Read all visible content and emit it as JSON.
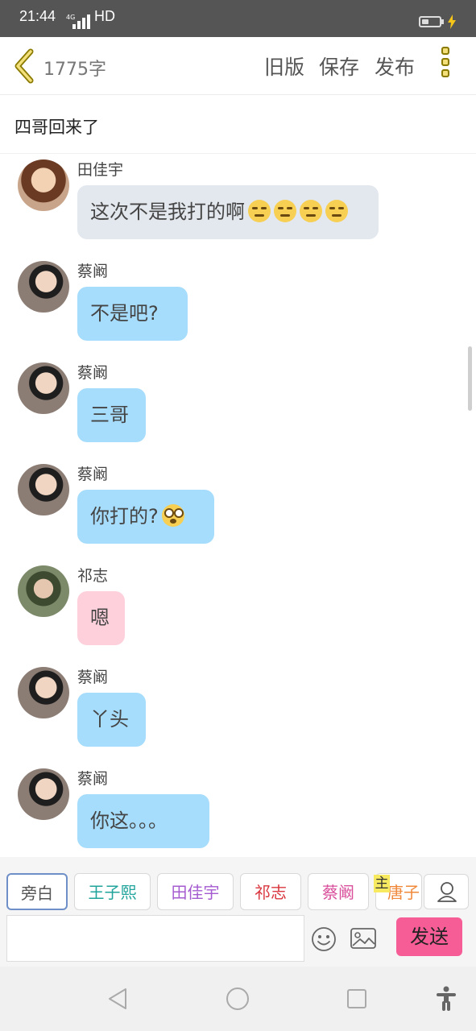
{
  "status_bar": {
    "time": "21:44",
    "network": "4G",
    "hd": "HD"
  },
  "header": {
    "word_count": "1775字",
    "old_version_label": "旧版",
    "save_label": "保存",
    "publish_label": "发布"
  },
  "title": "四哥回来了",
  "messages": [
    {
      "name": "田佳宇",
      "text": "这次不是我打的啊",
      "bubble_color": "#e3e8ee",
      "emoji_count": 4,
      "emoji": "unamused-emoji"
    },
    {
      "name": "蔡阚",
      "text": "不是吧?",
      "bubble_color": "#a6dcfc"
    },
    {
      "name": "蔡阚",
      "text": "三哥",
      "bubble_color": "#a6dcfc"
    },
    {
      "name": "蔡阚",
      "text": "你打的?",
      "bubble_color": "#a6dcfc",
      "emoji_count": 1,
      "emoji": "flushed-emoji"
    },
    {
      "name": "祁志",
      "text": "嗯",
      "bubble_color": "#fdd0dc"
    },
    {
      "name": "蔡阚",
      "text": "丫头",
      "bubble_color": "#a6dcfc"
    },
    {
      "name": "蔡阚",
      "text": "你这。。。",
      "bubble_color": "#a6dcfc"
    }
  ],
  "roles": [
    {
      "label": "旁白",
      "color": "#555555"
    },
    {
      "label": "王子熙",
      "color": "#1fa39a"
    },
    {
      "label": "田佳宇",
      "color": "#a55bd0"
    },
    {
      "label": "祁志",
      "color": "#d9363e"
    },
    {
      "label": "蔡阚",
      "color": "#d94f9b"
    },
    {
      "label": "唐子",
      "color": "#f0883a"
    }
  ],
  "main_tag": "主",
  "input": {
    "placeholder": ""
  },
  "send_label": "发送",
  "colors": {
    "accent": "#f65c95",
    "status_bar": "#555555"
  }
}
